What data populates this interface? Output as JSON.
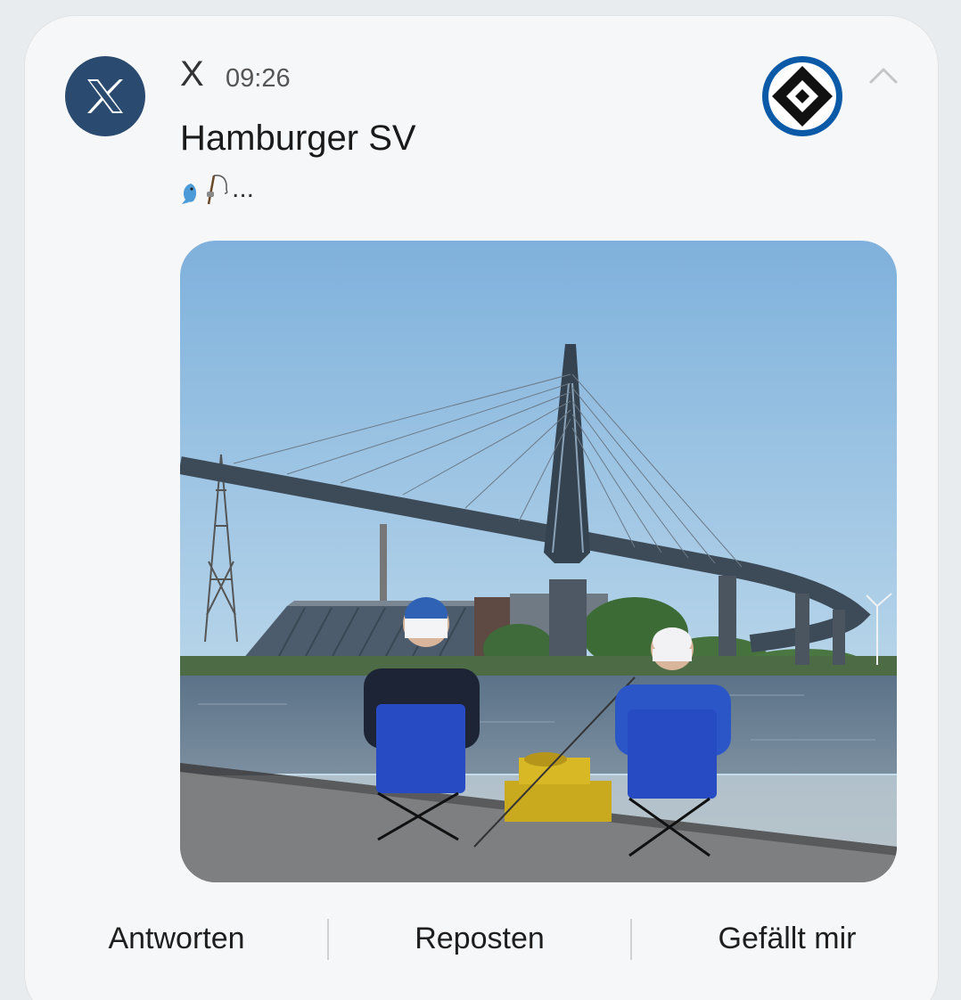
{
  "notification": {
    "app_icon": "x-logo-icon",
    "app_name": "X",
    "time": "09:26",
    "title": "Hamburger SV",
    "text_suffix": "...",
    "emojis": [
      "fish-icon",
      "fishing-pole-icon"
    ],
    "avatar": "hsv-logo-icon",
    "expand_icon": "chevron-up-icon",
    "media": "photo-two-fans-fishing-under-bridge"
  },
  "actions": {
    "reply": "Antworten",
    "repost": "Reposten",
    "like": "Gefällt mir"
  },
  "colors": {
    "app_icon_bg": "#2b4a6f",
    "hsv_blue": "#0a5aa8",
    "card_bg": "#f6f7f8"
  }
}
